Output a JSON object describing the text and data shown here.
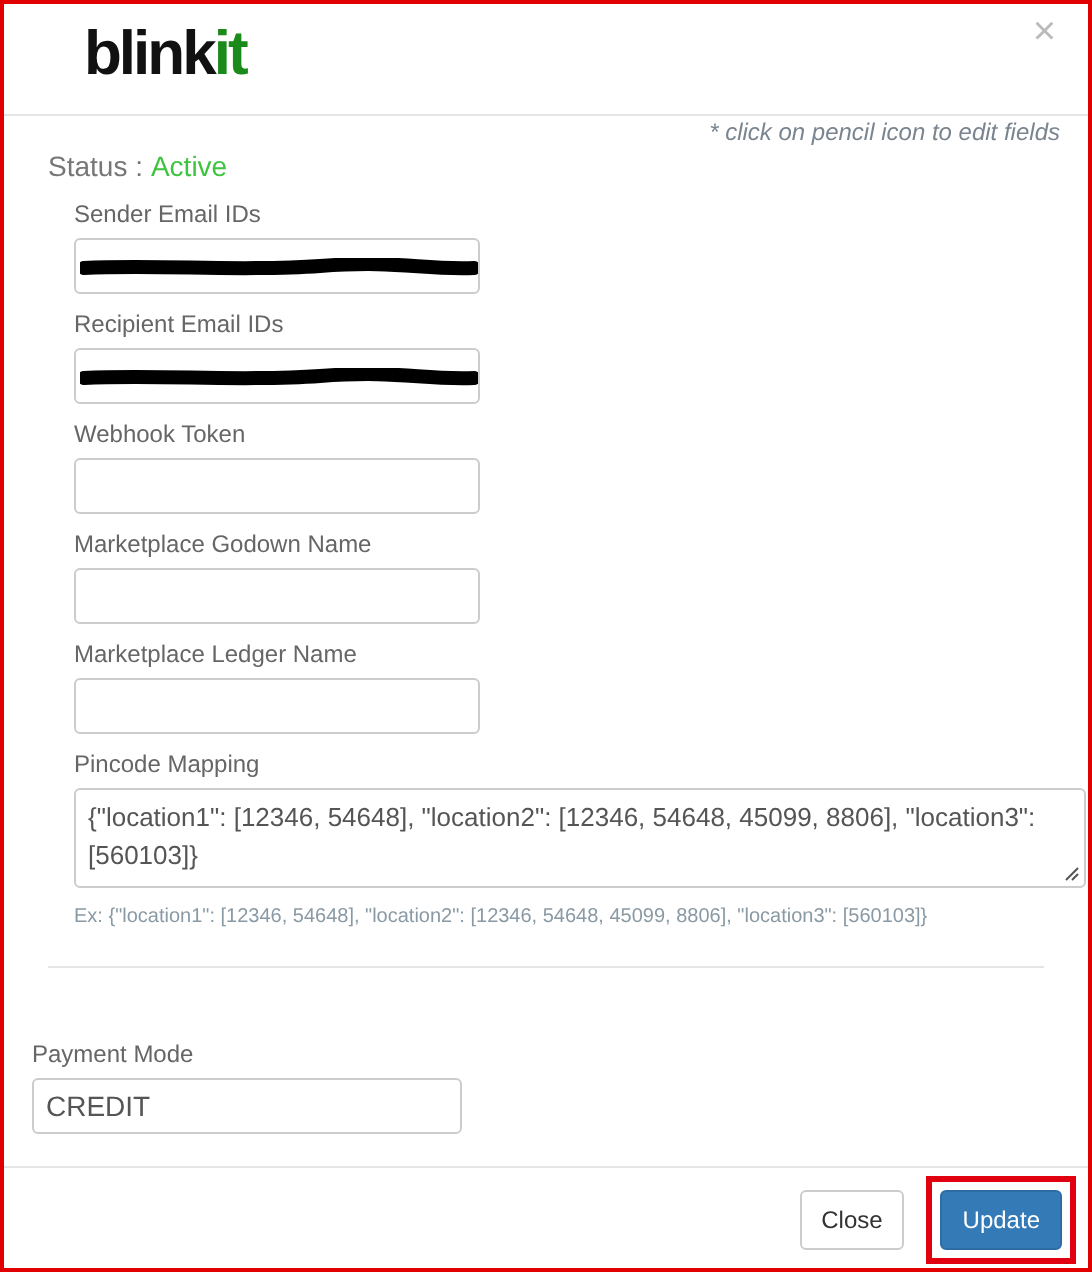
{
  "logo": {
    "dark_part": "blink",
    "accent_part": "it"
  },
  "close_symbol": "×",
  "hint": "* click on pencil icon to edit fields",
  "status": {
    "label": "Status :",
    "value": "Active",
    "active": true
  },
  "fields": [
    {
      "kind": "input",
      "label": "Sender Email IDs",
      "redacted": true
    },
    {
      "kind": "input",
      "label": "Recipient Email IDs",
      "redacted": true
    },
    {
      "kind": "input",
      "label": "Webhook Token",
      "redacted": false
    },
    {
      "kind": "input",
      "label": "Marketplace Godown Name",
      "redacted": false
    },
    {
      "kind": "input",
      "label": "Marketplace Ledger Name",
      "redacted": false
    },
    {
      "kind": "textarea",
      "label": "Pincode Mapping",
      "value": "{\"location1\": [12346, 54648], \"location2\": [12346, 54648, 45099, 8806], \"location3\": [560103]}",
      "help": "Ex: {\"location1\": [12346, 54648], \"location2\": [12346, 54648, 45099, 8806], \"location3\": [560103]}"
    }
  ],
  "payment_mode": {
    "label": "Payment Mode",
    "value": "CREDIT"
  },
  "buttons": [
    {
      "kind": "default",
      "label": "Close",
      "highlighted": false
    },
    {
      "kind": "primary",
      "label": "Update",
      "highlighted": true
    }
  ]
}
